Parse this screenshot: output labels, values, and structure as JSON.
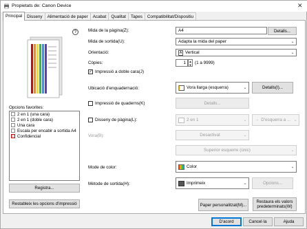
{
  "window": {
    "title": "Propietats de: Canon Device"
  },
  "tabs": [
    {
      "label": "Principal"
    },
    {
      "label": "Disseny"
    },
    {
      "label": "Alimentació de paper"
    },
    {
      "label": "Acabat"
    },
    {
      "label": "Qualitat"
    },
    {
      "label": "Tapes"
    },
    {
      "label": "Compatibilitat/Dispositiu"
    }
  ],
  "left": {
    "favorites_label": "Opcions favorites:",
    "favorites": [
      {
        "label": "2 en 1 (una cara)"
      },
      {
        "label": "2 en 1 (doble cara)"
      },
      {
        "label": "Una cara"
      },
      {
        "label": "Escala per encabir a sortida A4"
      },
      {
        "label": "Confidencial"
      }
    ],
    "register_button": "Registra...",
    "reset_button": "Restableix les opcions d'impressió"
  },
  "form": {
    "page_size_label": "Mida de la pàgina(Z):",
    "page_size_value": "A4",
    "details_button": "Detalls...",
    "output_size_label": "Mida de sortida(U):",
    "output_size_value": "Adapta la mida del paper",
    "orientation_label": "Orientació:",
    "orientation_value": "Vertical",
    "copies_label": "Còpies:",
    "copies_value": "1",
    "copies_range": "(1 a 9999)",
    "duplex_label": "Impressió a doble cara(J)",
    "binding_label": "Ubicació d'enquadernació:",
    "binding_value": "Vora llarga (esquerra)",
    "binding_details_button": "Detalls(I)...",
    "booklet_label": "Impressió de quaderns(K)",
    "booklet_details_button": "Detalls...",
    "layout_label": "Disseny de pàgina(L):",
    "layout_value": "2 en 1",
    "layout_order_value": "D'esquerra a ...",
    "border_label": "Vora(B):",
    "border_value": "Desactivat",
    "position_value": "Superior esquerre (únic)",
    "color_mode_label": "Mode de color:",
    "color_mode_value": "Color",
    "output_method_label": "Mètode de sortida(H):",
    "output_method_value": "Imprimeix",
    "output_options_button": "Opcions...",
    "custom_paper_button": "Paper personalitzat(M)...",
    "restore_defaults_button": "Restaura els valors predeterminats(W)"
  },
  "footer": {
    "ok_button": "D'acord",
    "cancel_button": "Cancel·la",
    "help_button": "Ajuda"
  }
}
